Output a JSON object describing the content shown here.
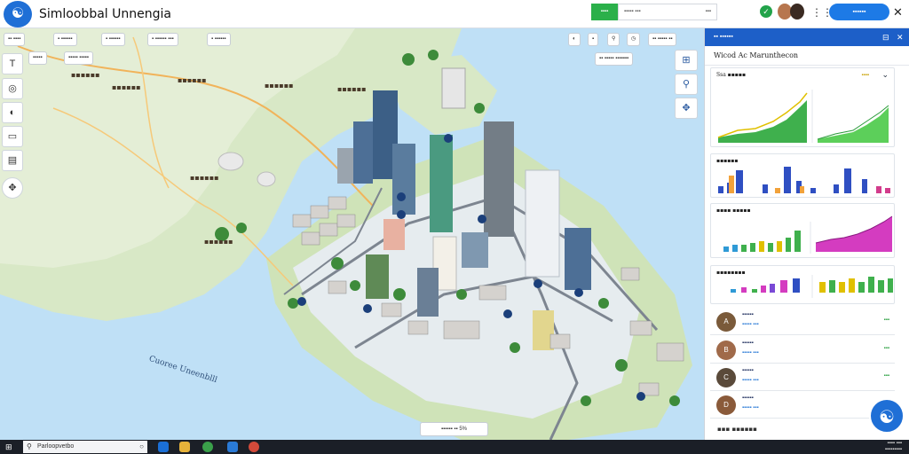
{
  "app": {
    "title": "Simloobbal Unnengia",
    "logo_glyph": "☯"
  },
  "topbar": {
    "status_pill": "▪▪▪▪",
    "search_text": "▪▪▪▪▪ ▪▪▪",
    "search_chevron": "▪▪▪",
    "check_glyph": "✓",
    "grid_glyph": "⋮⋮",
    "primary_button": "▪▪▪▪▪▪",
    "close_glyph": "✕"
  },
  "map": {
    "chips_row1": [
      "▪▪ ▪▪▪▪",
      "▪ ▪▪▪▪▪▪",
      "▪ ▪▪▪▪▪▪",
      "▪ ▪▪▪▪▪▪ ▪▪▪",
      "▪ ▪▪▪▪▪▪"
    ],
    "chips_row2": [
      "▪▪▪▪▪",
      "▪▪▪▪▪ ▪▪▪▪▪"
    ],
    "top_right_chips": [
      "◐",
      "▪",
      "⚲",
      "◷",
      "▪▪ ▪▪▪▪▪ ▪▪"
    ],
    "layer_chip": "▪▪ ▪▪▪▪▪ ▪▪▪▪▪▪▪",
    "left_tools": [
      "T",
      "◎",
      "◐",
      "▭",
      "▤",
      "✥"
    ],
    "right_tools": [
      "⊞",
      "⚲",
      "✥"
    ],
    "zoom_text": "▪▪▪▪▪▪ ▪▪ 5%",
    "place_labels": [
      "▪▪▪▪▪▪",
      "▪▪▪▪▪▪",
      "▪▪▪▪▪▪",
      "▪▪▪▪▪▪",
      "▪▪▪▪▪▪",
      "▪▪▪▪▪▪",
      "▪▪▪▪▪▪"
    ],
    "sea_label": "Cuoree Uneenblll"
  },
  "panel": {
    "header_title": "▪▪ ▪▪▪▪▪▪",
    "header_icons": [
      "⊟",
      "✕"
    ],
    "subtitle": "Wicod Ac Marunthecon",
    "card1": {
      "title": "Ssa ▪▪▪▪▪",
      "metric": "▪▪▪▪",
      "chevron": "⌄"
    },
    "card2": {
      "title": "▪▪▪▪▪▪"
    },
    "card3": {
      "title": "▪▪▪▪ ▪▪▪▪▪"
    },
    "card4": {
      "title": "▪▪▪▪▪▪▪▪"
    },
    "people": [
      {
        "initial": "A",
        "name": "▪▪▪▪▪▪",
        "sub": "▪▪▪▪▪ ▪▪▪",
        "value": "▪▪▪"
      },
      {
        "initial": "B",
        "name": "▪▪▪▪▪▪",
        "sub": "▪▪▪▪▪ ▪▪▪",
        "value": "▪▪▪"
      },
      {
        "initial": "C",
        "name": "▪▪▪▪▪▪",
        "sub": "▪▪▪▪▪ ▪▪▪",
        "value": "▪▪▪"
      },
      {
        "initial": "D",
        "name": "▪▪▪▪▪▪",
        "sub": "▪▪▪▪▪ ▪▪▪",
        "value": "▪▪▪"
      }
    ],
    "footer": "▪▪▪ ▪▪▪▪▪▪",
    "fab_glyph": "☯"
  },
  "taskbar": {
    "start_glyph": "⊞",
    "search_placeholder": "Parloopvetbo",
    "search_glyph": "⚲",
    "cortana_glyph": "○",
    "time_line1": "▪▪▪▪ ▪▪▪",
    "time_line2": "▪▪▪▪▪▪▪▪▪"
  },
  "colors": {
    "accent": "#1d5fc8",
    "primary_button": "#1d7ae6",
    "success": "#2bb04a",
    "water": "#bfe0f6",
    "land": "#d9e8c9"
  }
}
